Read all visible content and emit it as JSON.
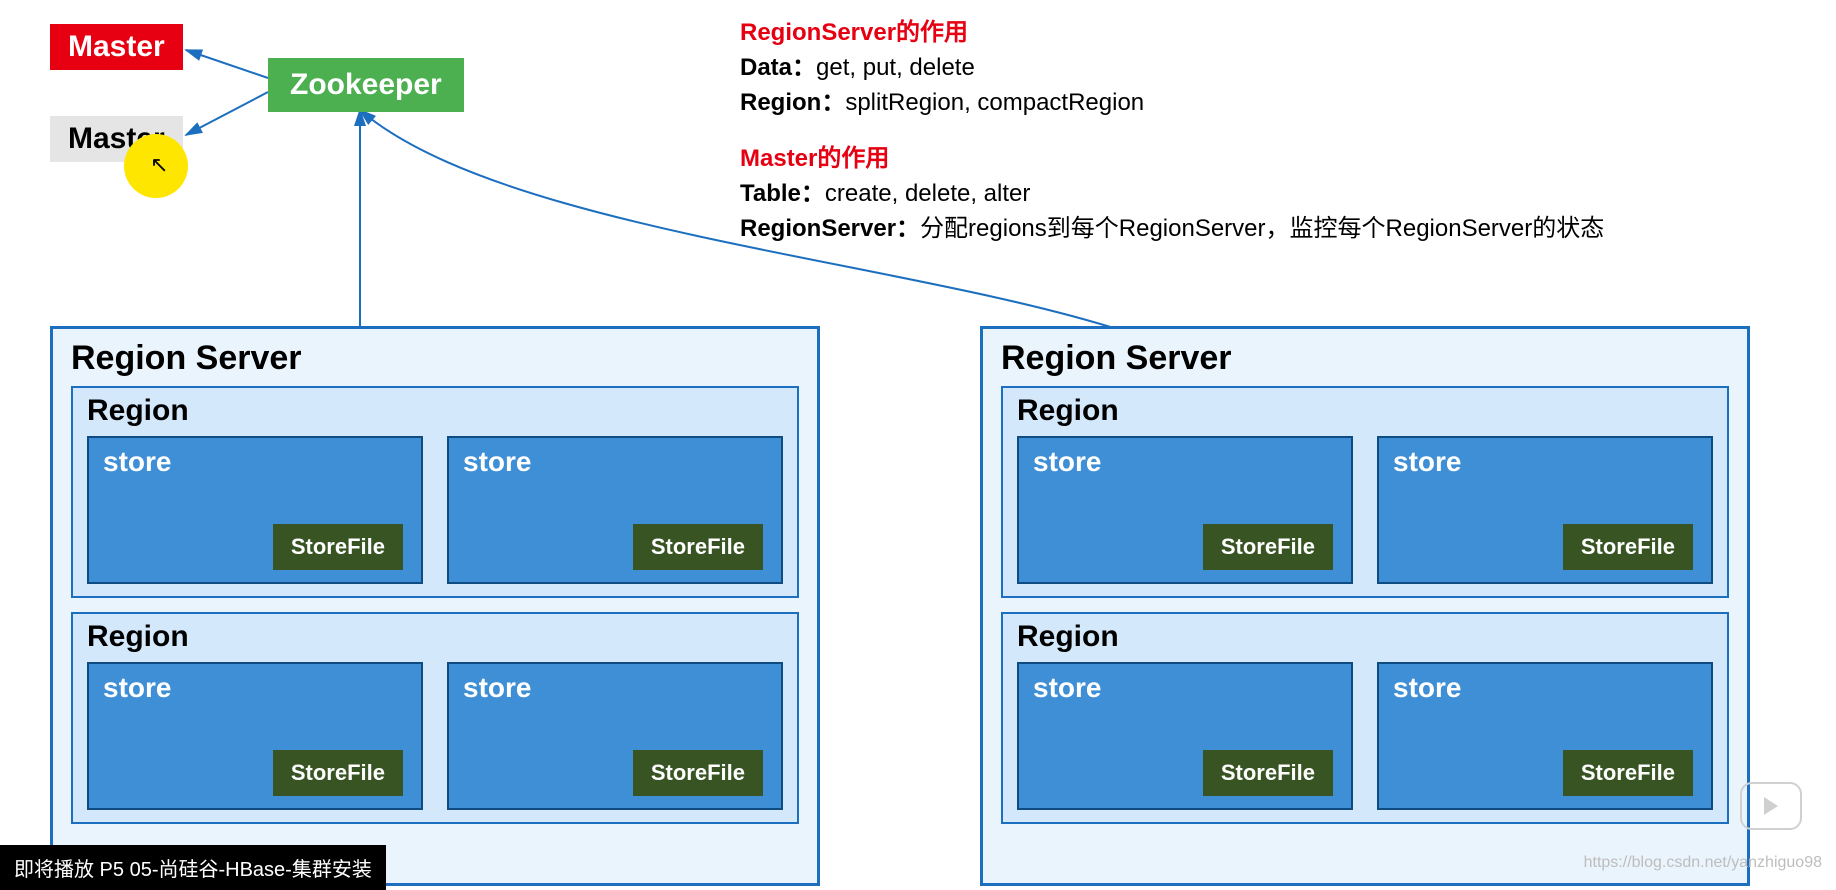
{
  "masters": {
    "active_label": "Master",
    "standby_label": "Master"
  },
  "zookeeper": {
    "label": "Zookeeper"
  },
  "desc": {
    "rs_header": "RegionServer的作用",
    "rs_line1_key": "Data：",
    "rs_line1_val": "get, put, delete",
    "rs_line2_key": "Region：",
    "rs_line2_val": "splitRegion, compactRegion",
    "m_header": "Master的作用",
    "m_line1_key": "Table：",
    "m_line1_val": "create, delete, alter",
    "m_line2_key": "RegionServer：",
    "m_line2_val": "分配regions到每个RegionServer，监控每个RegionServer的状态"
  },
  "region_servers": [
    {
      "title": "Region Server",
      "regions": [
        {
          "title": "Region",
          "stores": [
            {
              "label": "store",
              "file": "StoreFile"
            },
            {
              "label": "store",
              "file": "StoreFile"
            }
          ]
        },
        {
          "title": "Region",
          "stores": [
            {
              "label": "store",
              "file": "StoreFile"
            },
            {
              "label": "store",
              "file": "StoreFile"
            }
          ]
        }
      ]
    },
    {
      "title": "Region Server",
      "regions": [
        {
          "title": "Region",
          "stores": [
            {
              "label": "store",
              "file": "StoreFile"
            },
            {
              "label": "store",
              "file": "StoreFile"
            }
          ]
        },
        {
          "title": "Region",
          "stores": [
            {
              "label": "store",
              "file": "StoreFile"
            },
            {
              "label": "store",
              "file": "StoreFile"
            }
          ]
        }
      ]
    }
  ],
  "caption": "即将播放 P5 05-尚硅谷-HBase-集群安装",
  "watermark": "https://blog.csdn.net/yanzhiguo98"
}
